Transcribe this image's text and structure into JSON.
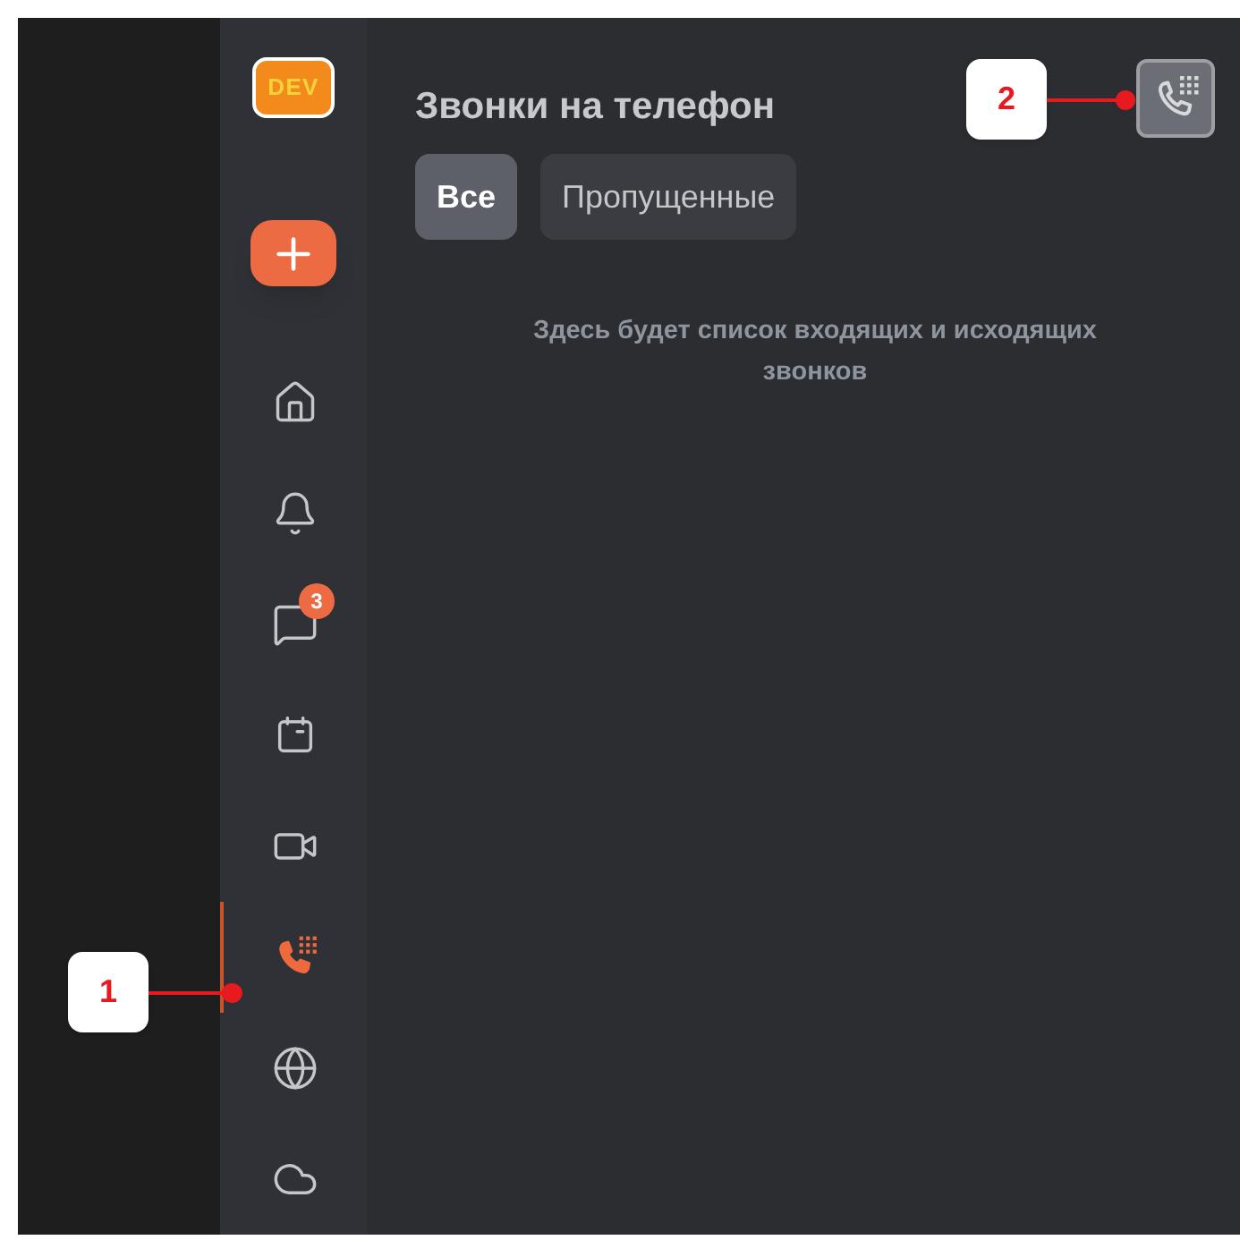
{
  "sidebar": {
    "logo": "DEV",
    "items": [
      {
        "kind": "home",
        "selected": false
      },
      {
        "kind": "bell",
        "selected": false
      },
      {
        "kind": "chat",
        "selected": false,
        "badge": "3"
      },
      {
        "kind": "calendar",
        "selected": false
      },
      {
        "kind": "video",
        "selected": false
      },
      {
        "kind": "phone",
        "selected": true
      },
      {
        "kind": "globe",
        "selected": false
      },
      {
        "kind": "cloud",
        "selected": false
      }
    ]
  },
  "title": "Звонки на телефон",
  "tabs": [
    {
      "label": "Все",
      "selected": true
    },
    {
      "label": "Пропущенные",
      "selected": false
    }
  ],
  "empty_text": "Здесь будет список входящих и исходящих звонков",
  "annotations": [
    {
      "label": "1",
      "kind": "left"
    },
    {
      "label": "2",
      "kind": "top"
    }
  ]
}
